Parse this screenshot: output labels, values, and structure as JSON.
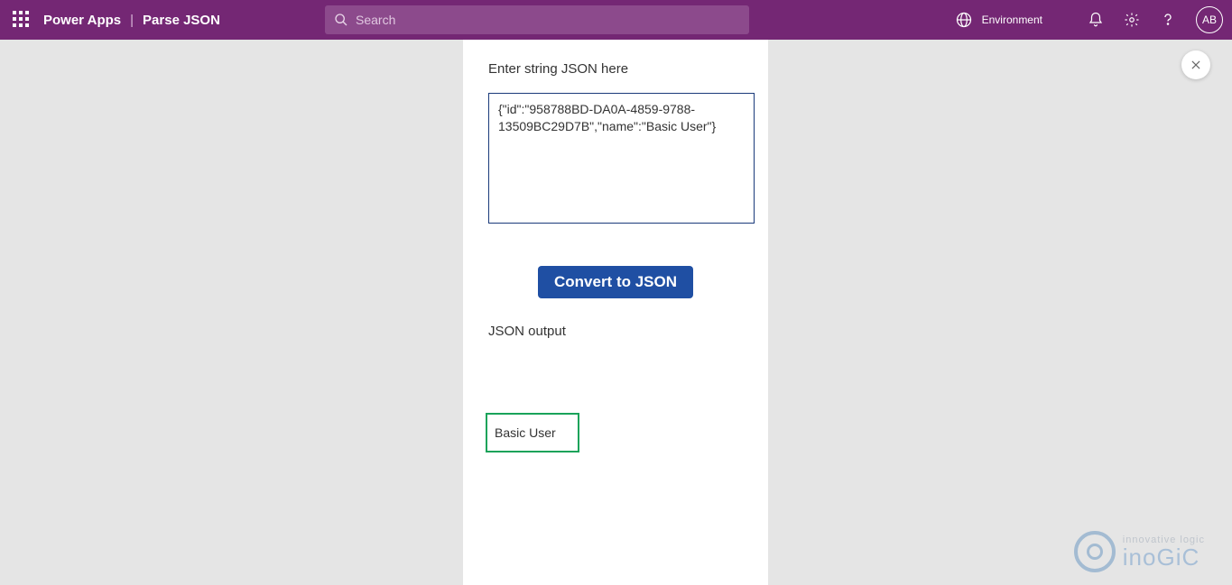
{
  "header": {
    "app_name": "Power Apps",
    "page_name": "Parse JSON",
    "search_placeholder": "Search",
    "environment_label": "Environment",
    "avatar_initials": "AB"
  },
  "main": {
    "input_label": "Enter string JSON here",
    "input_value": "{\"id\":\"958788BD-DA0A-4859-9788-13509BC29D7B\",\"name\":\"Basic User\"}",
    "convert_button": "Convert to JSON",
    "output_label": "JSON output",
    "output_value": "Basic User"
  },
  "watermark": {
    "line1": "innovative logic",
    "line2": "inoGiC"
  }
}
